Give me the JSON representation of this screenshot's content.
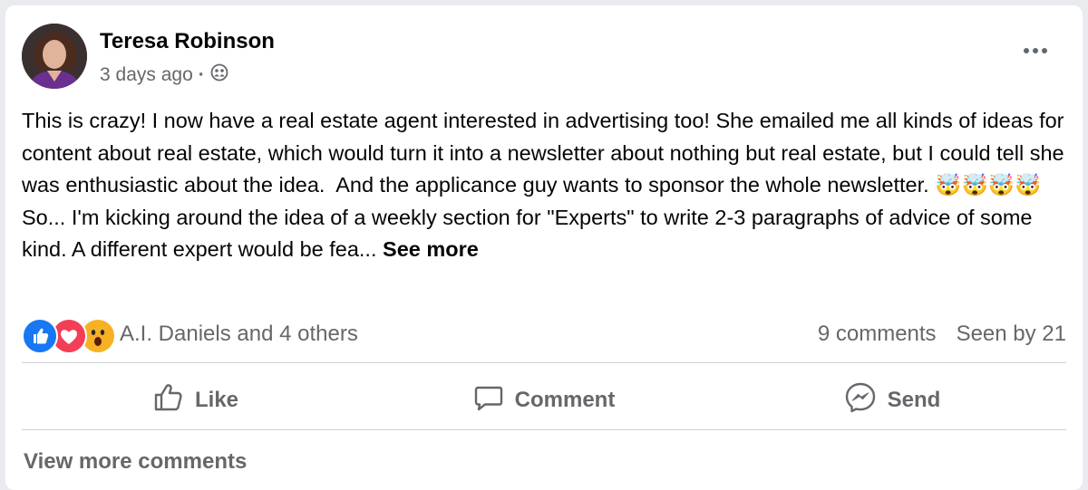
{
  "post": {
    "author": "Teresa Robinson",
    "time": "3 days ago",
    "audience_icon": "group-icon",
    "body": "This is crazy! I now have a real estate agent interested in advertising too! She emailed me all kinds of ideas for content about real estate, which would turn it into a newsletter about nothing but real estate, but I could tell she was enthusiastic about the idea.  And the applicance guy wants to sponsor the whole newsletter. ",
    "body_emojis": [
      "🤯",
      "🤯",
      "🤯",
      "🤯"
    ],
    "body_cont": " So... I'm kicking around the idea of a weekly section for \"Experts\" to write 2-3 paragraphs of advice of some kind. A different expert would be fea... ",
    "see_more": "See more"
  },
  "reactions": {
    "icons": [
      "like-icon",
      "love-icon",
      "wow-icon"
    ],
    "names": "A.I. Daniels and 4 others",
    "comments": "9 comments",
    "seen": "Seen by 21"
  },
  "actions": {
    "like": "Like",
    "comment": "Comment",
    "send": "Send"
  },
  "footer": {
    "view_more": "View more comments"
  },
  "colors": {
    "like_blue": "#1877f2",
    "love_red": "#f33e58",
    "wow_yellow": "#f7b125",
    "muted_text": "#65676b"
  }
}
